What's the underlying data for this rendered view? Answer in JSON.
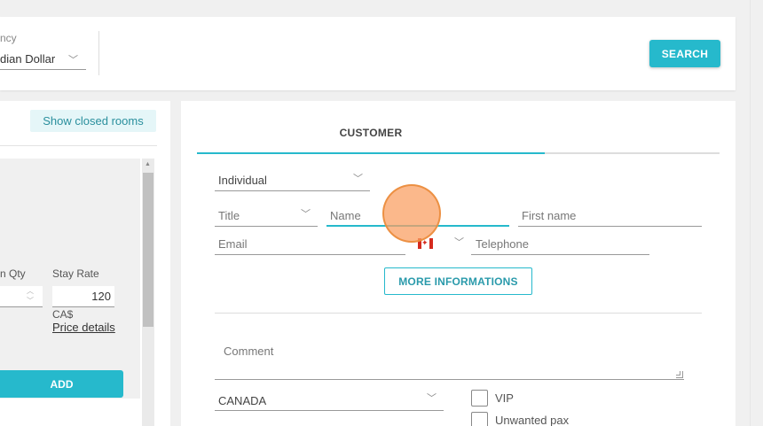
{
  "header": {
    "currency_label": "ncy",
    "currency_value": "dian Dollar",
    "search_label": "SEARCH"
  },
  "left": {
    "show_closed_label": "Show closed rooms",
    "qty_label": "n Qty",
    "stay_rate_label": "Stay Rate",
    "stay_rate_value": "120",
    "currency_symbol": "CA$",
    "price_details_link": "Price details",
    "add_label": "ADD"
  },
  "customer": {
    "tab_label": "CUSTOMER",
    "type_value": "Individual",
    "title_placeholder": "Title",
    "name_placeholder": "Name",
    "first_name_placeholder": "First name",
    "email_placeholder": "Email",
    "telephone_placeholder": "Telephone",
    "country_code_flag": "canada-flag-icon",
    "more_info_label": "MORE INFORMATIONS",
    "comment_placeholder": "Comment",
    "country_value": "CANADA",
    "vip_label": "VIP",
    "unwanted_label": "Unwanted pax"
  },
  "colors": {
    "accent": "#26b9cc",
    "accent_light": "#e5f6f8"
  }
}
